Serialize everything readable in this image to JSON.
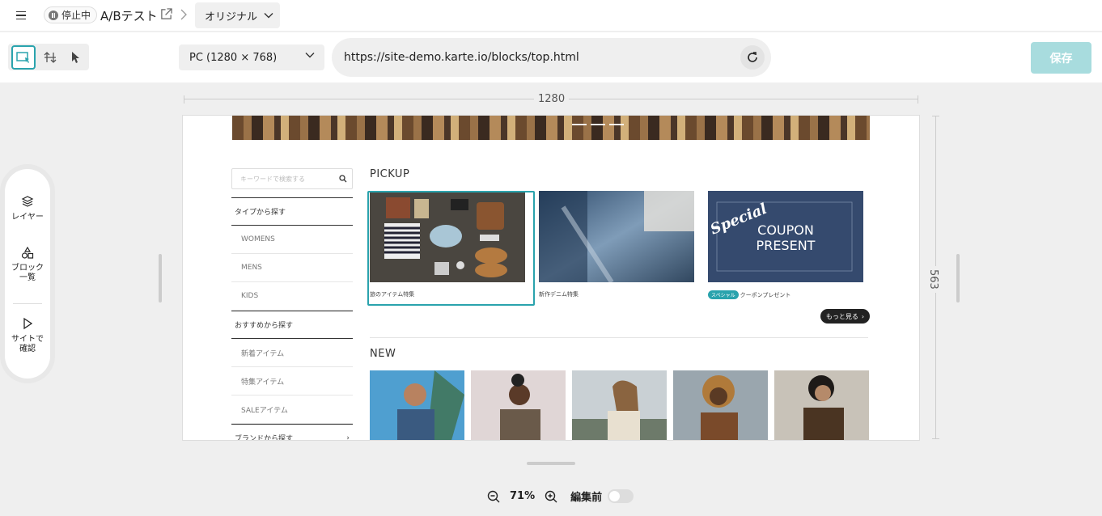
{
  "header": {
    "status_label": "停止中",
    "test_name": "A/Bテスト",
    "variant_label": "オリジナル"
  },
  "toolbar": {
    "device_label": "PC (1280 × 768)",
    "url": "https://site-demo.karte.io/blocks/top.html",
    "save_label": "保存"
  },
  "ruler": {
    "width_label": "1280",
    "height_label": "563"
  },
  "left_panel": {
    "layers_label": "レイヤー",
    "blocks_label_1": "ブロック",
    "blocks_label_2": "一覧",
    "preview_label_1": "サイトで",
    "preview_label_2": "確認"
  },
  "site": {
    "search_placeholder": "キーワードで検索する",
    "categories": [
      {
        "label": "タイプから探す",
        "kind": "head"
      },
      {
        "label": "WOMENS",
        "kind": "sub"
      },
      {
        "label": "MENS",
        "kind": "sub"
      },
      {
        "label": "KIDS",
        "kind": "sub"
      },
      {
        "label": "おすすめから探す",
        "kind": "head"
      },
      {
        "label": "新着アイテム",
        "kind": "sub"
      },
      {
        "label": "特集アイテム",
        "kind": "sub"
      },
      {
        "label": "SALEアイテム",
        "kind": "sub"
      },
      {
        "label": "ブランドから探す",
        "kind": "head"
      }
    ],
    "pickup_title": "PICKUP",
    "pickup": [
      {
        "caption": "旅のアイテム特集"
      },
      {
        "caption": "新作デニム特集"
      },
      {
        "caption": "クーポンプレゼント",
        "badge": "スペシャル"
      }
    ],
    "coupon": {
      "script": "Special",
      "line1": "COUPON",
      "line2": "PRESENT"
    },
    "more_label": "もっと見る",
    "new_title": "NEW"
  },
  "zoom": {
    "level": "71%",
    "toggle_label": "編集前"
  },
  "colors": {
    "accent": "#2aa3ad",
    "save_disabled": "#a8dcde",
    "coupon_bg": "#354a6e"
  }
}
